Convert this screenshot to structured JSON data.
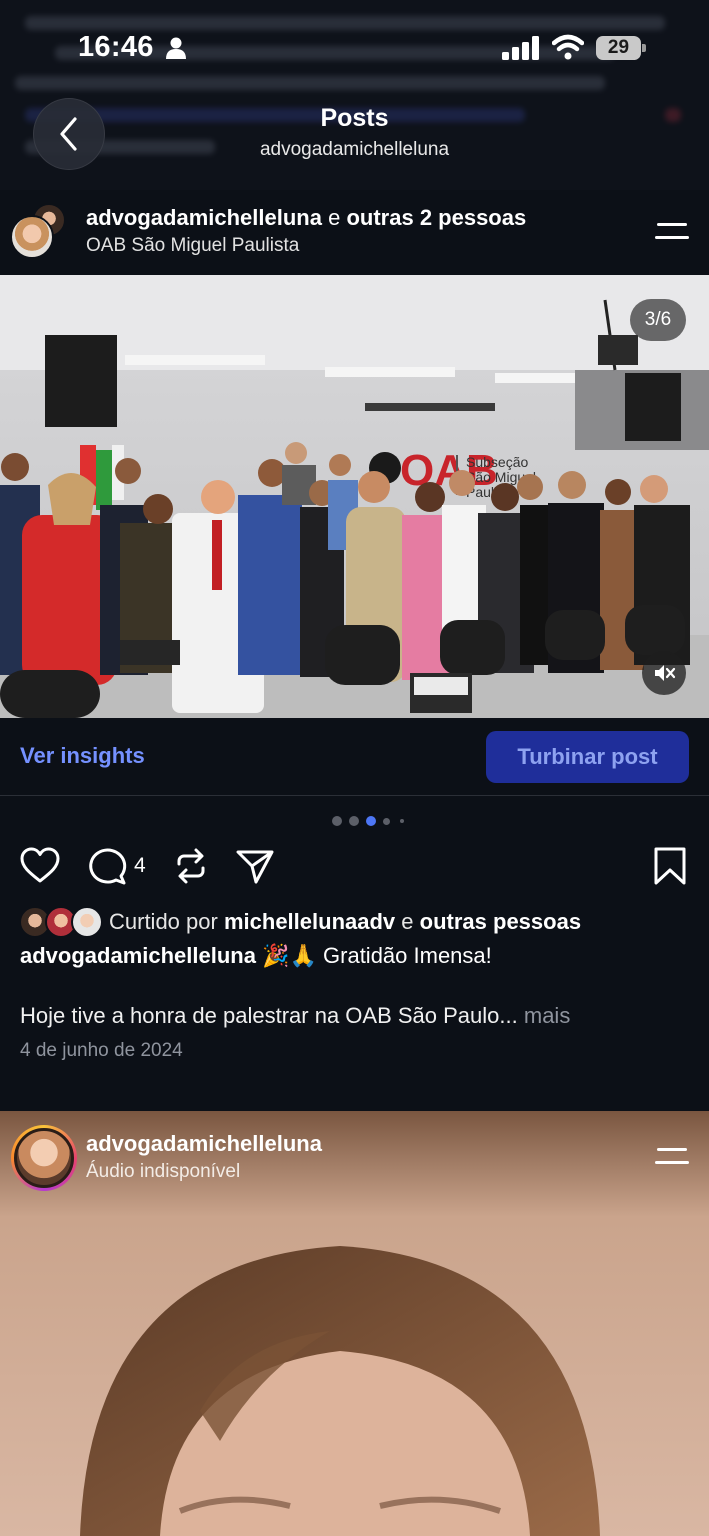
{
  "status_bar": {
    "time": "16:46",
    "battery": "29"
  },
  "header": {
    "title": "Posts",
    "subtitle": "advogadamichelleluna"
  },
  "post": {
    "author": "advogadamichelleluna",
    "author_suffix_conj": "e",
    "author_suffix": "outras 2 pessoas",
    "location": "OAB São Miguel Paulista",
    "image_counter": "3/6",
    "ver_insights": "Ver insights",
    "turbinar_post": "Turbinar post",
    "carousel_dots": 5,
    "carousel_active": 3,
    "comment_count": "4",
    "liked_prefix": "Curtido por",
    "liked_user": "michellelunaadv",
    "liked_conj": "e",
    "liked_suffix": "outras pessoas",
    "caption_author": "advogadamichelleluna",
    "caption_emoji": "🎉🙏",
    "caption_text": "Gratidão Imensa!",
    "caption_body": "Hoje tive a honra de palestrar na OAB São Paulo...",
    "caption_more": "mais",
    "date": "4 de junho de 2024"
  },
  "photo": {
    "sign_brand": "OAB",
    "sign_line1": "Subseção",
    "sign_line2": "São Miguel",
    "sign_line3": "Paulista"
  },
  "post2": {
    "author": "advogadamichelleluna",
    "subtitle": "Áudio indisponível"
  },
  "icons": [
    "person-icon",
    "signal-icon",
    "wifi-icon",
    "battery-icon",
    "back-arrow-icon",
    "menu-icon",
    "mute-icon",
    "heart-icon",
    "comment-icon",
    "repost-icon",
    "send-icon",
    "bookmark-icon"
  ],
  "colors": {
    "accent": "#7591ff",
    "boost_bg": "#1f2e9a",
    "background": "#0c1017"
  }
}
